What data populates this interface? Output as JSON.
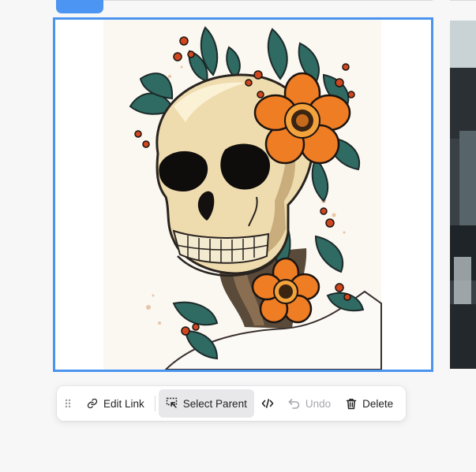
{
  "toolbar": {
    "edit_link_label": "Edit Link",
    "select_parent_label": "Select Parent",
    "undo_label": "Undo",
    "delete_label": "Delete"
  },
  "icons": {
    "drag": "drag-handle-icon",
    "edit_link": "link-icon",
    "select_parent": "select-parent-icon",
    "code": "code-icon",
    "undo": "undo-icon",
    "delete": "trash-icon"
  },
  "colors": {
    "selection": "#4a94ef",
    "accent_tab": "#4c95f2",
    "active_button": "#e8e8eb"
  }
}
